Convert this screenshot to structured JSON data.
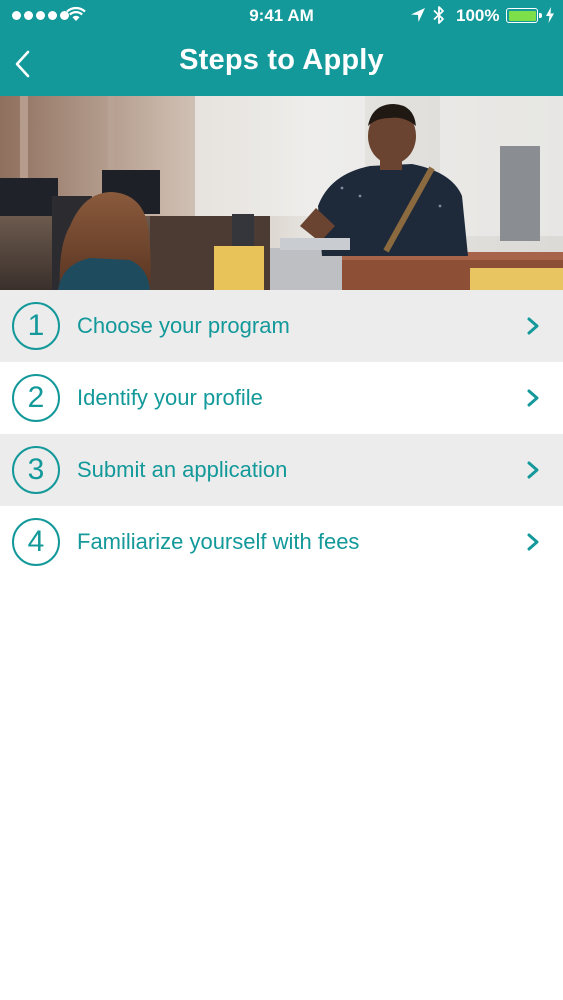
{
  "status_bar": {
    "time": "9:41 AM",
    "battery_percent": "100%",
    "icons": [
      "signal-dots",
      "wifi-icon",
      "location-arrow-icon",
      "bluetooth-icon",
      "battery-icon",
      "charging-bolt-icon"
    ]
  },
  "nav": {
    "title": "Steps to Apply",
    "back_icon": "chevron-left-icon"
  },
  "colors": {
    "brand": "#14999a",
    "row_shade": "#ececec",
    "battery_green": "#7ddf4a"
  },
  "steps": [
    {
      "number": "1",
      "label": "Choose your program"
    },
    {
      "number": "2",
      "label": "Identify your profile"
    },
    {
      "number": "3",
      "label": "Submit an application"
    },
    {
      "number": "4",
      "label": "Familiarize yourself with fees"
    }
  ]
}
